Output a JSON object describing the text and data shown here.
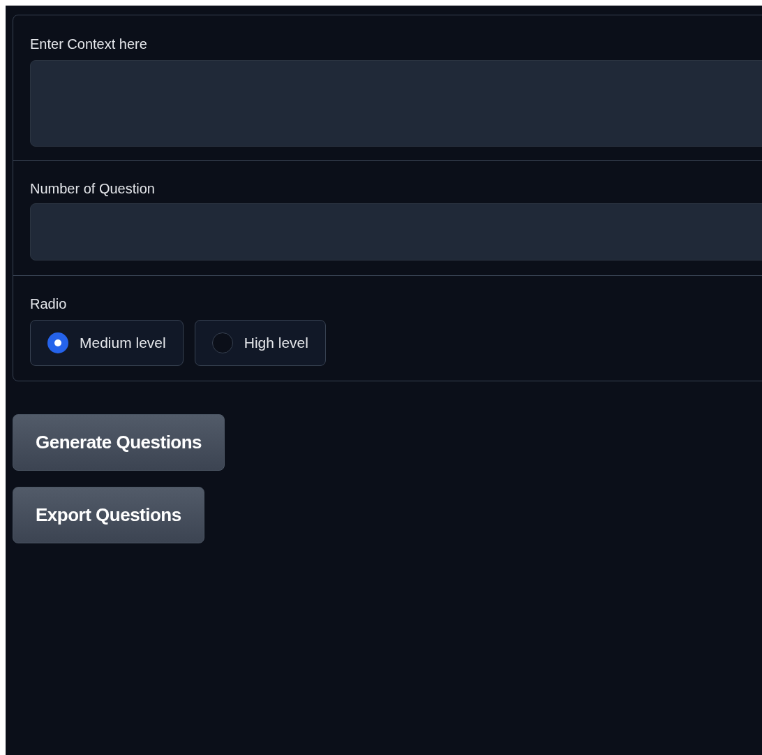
{
  "context": {
    "label": "Enter Context here"
  },
  "question_count": {
    "label": "Number of Question"
  },
  "radio": {
    "label": "Radio",
    "options": [
      {
        "label": "Medium level",
        "selected": true
      },
      {
        "label": "High level",
        "selected": false
      }
    ]
  },
  "buttons": [
    "Generate Questions",
    "Export Questions"
  ]
}
